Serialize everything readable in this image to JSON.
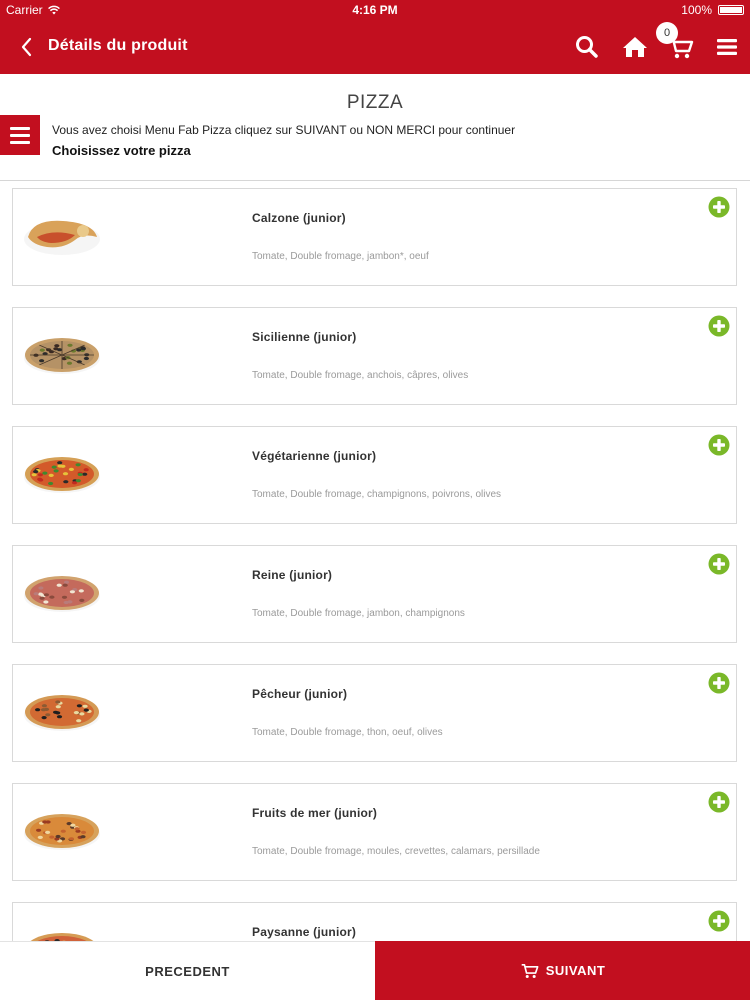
{
  "status_bar": {
    "carrier": "Carrier",
    "time": "4:16 PM",
    "battery": "100%"
  },
  "nav": {
    "title": "Détails du produit",
    "cart_count": "0",
    "icons": [
      "back-icon",
      "search-icon",
      "home-icon",
      "cart-icon",
      "menu-icon"
    ]
  },
  "page": {
    "title": "PIZZA",
    "message": "Vous avez choisi Menu Fab Pizza cliquez sur SUIVANT ou NON MERCI pour continuer",
    "subtitle": "Choisissez votre pizza"
  },
  "products": [
    {
      "name": "Calzone (junior)",
      "desc": "Tomate, Double fromage, jambon*, oeuf",
      "style": "calzone"
    },
    {
      "name": "Sicilienne (junior)",
      "desc": "Tomate, Double fromage, anchois, câpres, olives",
      "style": "sicilienne"
    },
    {
      "name": "Végétarienne (junior)",
      "desc": "Tomate, Double fromage, champignons, poivrons, olives",
      "style": "vegetarienne"
    },
    {
      "name": "Reine (junior)",
      "desc": "Tomate, Double fromage, jambon, champignons",
      "style": "reine"
    },
    {
      "name": "Pêcheur (junior)",
      "desc": "Tomate, Double fromage, thon, oeuf, olives",
      "style": "pecheur"
    },
    {
      "name": "Fruits de mer (junior)",
      "desc": "Tomate, Double fromage, moules, crevettes, calamars, persillade",
      "style": "fruits"
    },
    {
      "name": "Paysanne (junior)",
      "desc": "",
      "style": "paysanne"
    }
  ],
  "footer": {
    "prev_label": "PRECEDENT",
    "next_label": "SUIVANT"
  },
  "colors": {
    "brand_red": "#c20f1f",
    "add_green": "#7ab829"
  }
}
